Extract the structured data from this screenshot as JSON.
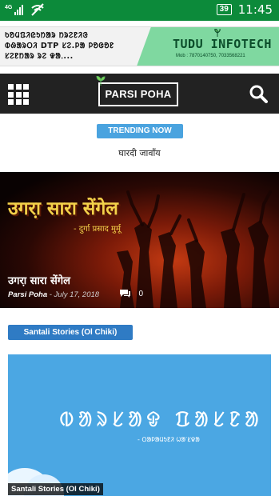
{
  "status_bar": {
    "network": "4G",
    "battery": "39",
    "time": "11:45"
  },
  "ad_banner": {
    "text_lines": [
      "ᱠᱚᱢᱯᱤᱭᱩᱴᱟᱨ ᱴᱨᱮᱱᱤᱝ",
      "ᱵᱷᱟᱨᱛᱤ DTP ᱥᱮ.ᱞᱟ ᱞᱚᱜᱚᱱ",
      "ᱥᱮᱱᱴᱟᱨ ᱨᱮ ᱫᱟᱹ..."
    ],
    "brand": "TUDU INFOTECH",
    "contact": "Mob : 7870140750, 7033568221"
  },
  "app_bar": {
    "logo_text": "PARSI POHA"
  },
  "trending": {
    "badge": "TRENDING NOW",
    "headline": "घारदी जावाँय"
  },
  "hero": {
    "art_title": "उगरा़ सारा सेंगेल",
    "art_author": "- दुर्गा प्रसाद मुर्मू",
    "title": "उगरा़ सारा सेंगेल",
    "author": "Parsi Poha",
    "date": "- July 17, 2018",
    "comments": "0"
  },
  "category": {
    "badge": "Santali Stories (Ol Chiki)",
    "card_art_title": "ᱵᱟᱨᱥᱟᱫ ᱯᱟᱥᱱᱟ",
    "card_art_author": "- ᱛᱟᱞᱟᱢᱩᱱᱤ ᱦᱟᱸᱥᱫᱟ",
    "card_label": "Santali Stories (Ol Chiki)"
  },
  "colors": {
    "status_bar": "#0c8a3a",
    "app_bar": "#222222",
    "trending_badge": "#4aa3df",
    "category_badge": "#2f7bc4"
  }
}
